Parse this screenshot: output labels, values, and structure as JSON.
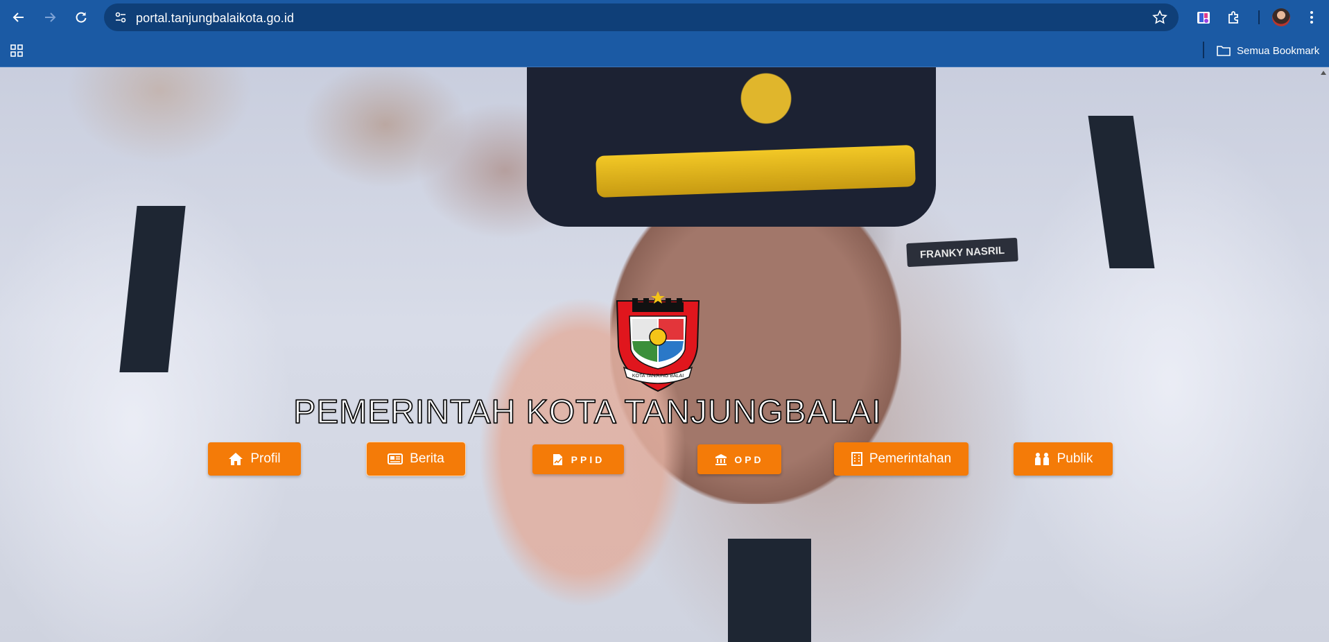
{
  "browser": {
    "url": "portal.tanjungbalaikota.go.id",
    "bookmark_folder": "Semua Bookmark",
    "accent": "#1b5aa4"
  },
  "page": {
    "title": "PEMERINTAH KOTA TANJUNGBALAI",
    "nameplate": "FRANKY NASRIL",
    "logo_text": "KOTA TANJUNG BALAI",
    "button_color": "#f47b08",
    "nav_buttons": [
      {
        "label": "Profil",
        "icon": "home-icon"
      },
      {
        "label": "Berita",
        "icon": "newspaper-icon"
      },
      {
        "label": "PPID",
        "icon": "file-signature-icon"
      },
      {
        "label": "OPD",
        "icon": "landmark-icon"
      },
      {
        "label": "Pemerintahan",
        "icon": "building-icon"
      },
      {
        "label": "Publik",
        "icon": "people-icon"
      }
    ]
  }
}
